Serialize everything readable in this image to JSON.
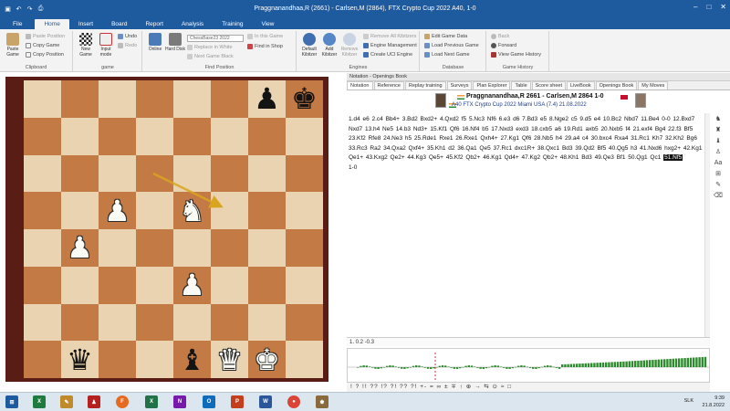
{
  "window": {
    "title": "Praggnanandhaa,R (2661) - Carlsen,M (2864), FTX Crypto Cup 2022  A40, 1-0"
  },
  "ribbon_tabs": [
    "File",
    "Home",
    "Insert",
    "Board",
    "Report",
    "Analysis",
    "Training",
    "View"
  ],
  "ribbon": {
    "clipboard": {
      "paste": "Paste Game",
      "copy_game": "Copy Game",
      "copy_position": "Copy Position",
      "paste_position": "Paste Position",
      "label": "Clipboard"
    },
    "game": {
      "new": "New Game",
      "input": "Input mode",
      "undo": "Undo",
      "redo": "Redo",
      "label": "game"
    },
    "find_position": {
      "online": "Online",
      "hard_disk": "Hard Disk",
      "db_combo": "ChessBase23 2022",
      "in_this_game": "In this Game",
      "find_in_shop": "Find in Shop",
      "replace_in_white": "Replace in White",
      "next_game_black": "Next Game Black",
      "label": "Find Position"
    },
    "engines": {
      "default_kibitzer": "Default Kibitzer",
      "add_kibitzer": "Add Kibitzer",
      "remove_kibitzer": "Remove Kibitzer",
      "remove_all": "Remove All Kibitzers",
      "engine_management": "Engine Management",
      "create_uci": "Create UCI Engine",
      "label": "Engines"
    },
    "database": {
      "edit_game_data": "Edit Game Data",
      "load_previous": "Load Previous Game",
      "load_next": "Load Next Game",
      "label": "Database"
    },
    "game_history": {
      "back": "Back",
      "forward": "Forward",
      "view_history": "View Game History",
      "label": "Game History"
    }
  },
  "notation": {
    "pane_title": "Notation - Openings Book",
    "tabs": [
      "Notation",
      "Reference",
      "Replay training",
      "Surveys",
      "Plan Explorer",
      "Table",
      "Score sheet",
      "LiveBook",
      "Openings Book",
      "My Moves"
    ],
    "players": "Praggnanandhaa,R 2661 - Carlsen,M 2864 1-0",
    "event": "A40 FTX Crypto Cup 2022 Miami USA (7.4) 21.08.2022",
    "moves_text": "1.d4 e6 2.c4 Bb4+ 3.Bd2 Bxd2+ 4.Qxd2 f5 5.Nc3 Nf6 6.e3 d6 7.Bd3 e5 8.Nge2 c5 9.d5 e4 10.Bc2 Nbd7 11.Be4 0-0 12.Bxd7 Nxd7 13.h4 Ne5 14.b3 Nd3+ 15.Kf1 Qf6 16.Nf4 b5 17.Nxd3 exd3 18.cxb5 a6 19.Rd1 axb5 20.Nxb5 f4 21.exf4 Bg4 22.f3 Bf5 23.Kf2 Rfe8 24.Ne3 h5 25.Rde1 Rxe1 26.Rxe1 Qxh4+ 27.Kg1 Qf6 28.Nb5 h4 29.a4 c4 30.bxc4 Rxa4 31.Rc1 Kh7 32.Kh2 Bg6 33.Rc3 Ra2 34.Qxa2 Qxf4+ 35.Kh1 d2 36.Qa1 Qe5 37.Rc1 dxc1R+ 38.Qxc1 Bd3 39.Qd2 Bf5 40.Qg5 h3 41.Nxd6 hxg2+ 42.Kg1 Qe1+ 43.Kxg2 Qe2+ 44.Kg3 Qe5+ 45.Kf2 Qb2+ 46.Kg1 Qd4+ 47.Kg2 Qb2+ 48.Kh1 Bd3 49.Qe3 Bf1 50.Qg1 Qc1",
    "current_move": "51.Nf5",
    "result": "1-0",
    "eval_row": "1.  0.2  -0.3",
    "nag_row": "!  ?  !!  ??  !?  ?!  ??  ?!  +-  =  ∞  ±  ∓  ↑  ⊕  →  ⇆  ⊙  ≈  □"
  },
  "board": {
    "rows": [
      [
        "",
        "",
        "",
        "",
        "",
        "",
        "bP",
        "bK"
      ],
      [
        "",
        "",
        "",
        "",
        "",
        "",
        "",
        ""
      ],
      [
        "",
        "",
        "",
        "",
        "",
        "",
        "",
        ""
      ],
      [
        "",
        "",
        "wP",
        "",
        "wN",
        "",
        "",
        ""
      ],
      [
        "",
        "wP",
        "",
        "",
        "",
        "",
        "",
        ""
      ],
      [
        "",
        "",
        "",
        "",
        "wP",
        "",
        "",
        ""
      ],
      [
        "",
        "",
        "",
        "",
        "",
        "",
        "",
        ""
      ],
      [
        "",
        "bQ",
        "",
        "",
        "bB",
        "wQ",
        "wK",
        ""
      ]
    ]
  },
  "taskbar": {
    "time": "9:39",
    "date": "21.8.2022",
    "lang": "SLK",
    "apps": [
      "windows-start",
      "excel-green",
      "pen-tool",
      "red-pawn",
      "firefox",
      "excel",
      "onenote",
      "outlook",
      "powerpoint",
      "word",
      "chrome",
      "chess-app"
    ]
  },
  "colors": {
    "accent": "#1e5a9e",
    "board_light": "#e9d3b0",
    "board_dark": "#c37a44",
    "frame": "#5a1d16",
    "arrow": "#d9a520",
    "graph_green": "#2e8b2e"
  }
}
